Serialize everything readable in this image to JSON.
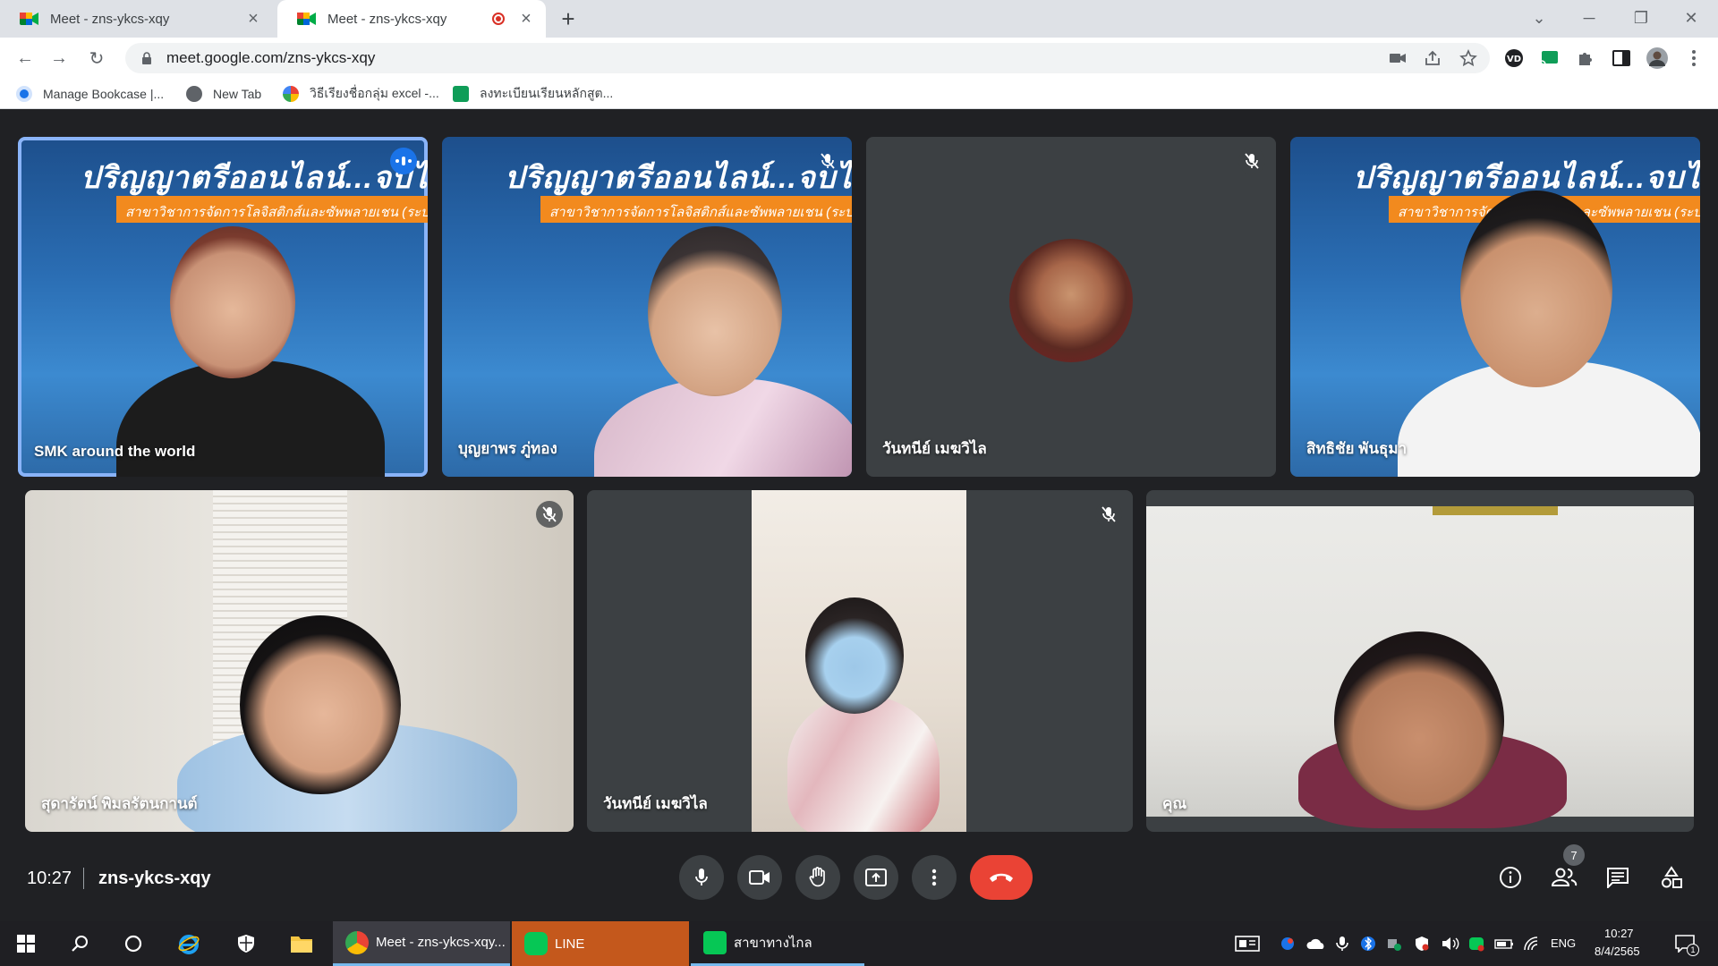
{
  "browser": {
    "tabs": [
      {
        "title": "Meet - zns-ykcs-xqy"
      },
      {
        "title": "Meet - zns-ykcs-xqy"
      }
    ],
    "url": "meet.google.com/zns-ykcs-xqy",
    "bookmarks": [
      {
        "label": "Manage Bookcase |..."
      },
      {
        "label": "New Tab"
      },
      {
        "label": "วิธีเรียงชื่อกลุ่ม excel -..."
      },
      {
        "label": "ลงทะเบียนเรียนหลักสูต..."
      }
    ]
  },
  "meet": {
    "slide_title": "ปริญญาตรีออนไลน์...จบได้จ",
    "slide_subtitle": "สาขาวิชาการจัดการโลจิสติกส์และซัพพลายเชน (ระบบ",
    "participants": [
      {
        "name": "SMK around the world"
      },
      {
        "name": "บุญยาพร ภู่ทอง"
      },
      {
        "name": "วันทนีย์ เมฆวิไล"
      },
      {
        "name": "สิทธิชัย พันธุมา"
      },
      {
        "name": "สุดารัตน์ พิมลรัตนกานต์"
      },
      {
        "name": "วันทนีย์ เมฆวิไล"
      },
      {
        "name": "คุณ"
      }
    ],
    "time": "10:27",
    "meeting_code": "zns-ykcs-xqy",
    "people_count": "7"
  },
  "taskbar": {
    "apps": [
      {
        "label": "Meet - zns-ykcs-xqy..."
      },
      {
        "label": "LINE"
      },
      {
        "label": "สาขาทางไกล"
      }
    ],
    "lang": "ENG",
    "time": "10:27",
    "date": "8/4/2565",
    "notif_count": "1"
  },
  "colors": {
    "accent": "#1a73e8",
    "end_call": "#ea4335",
    "bg": "#202124",
    "tile": "#3c4043"
  }
}
